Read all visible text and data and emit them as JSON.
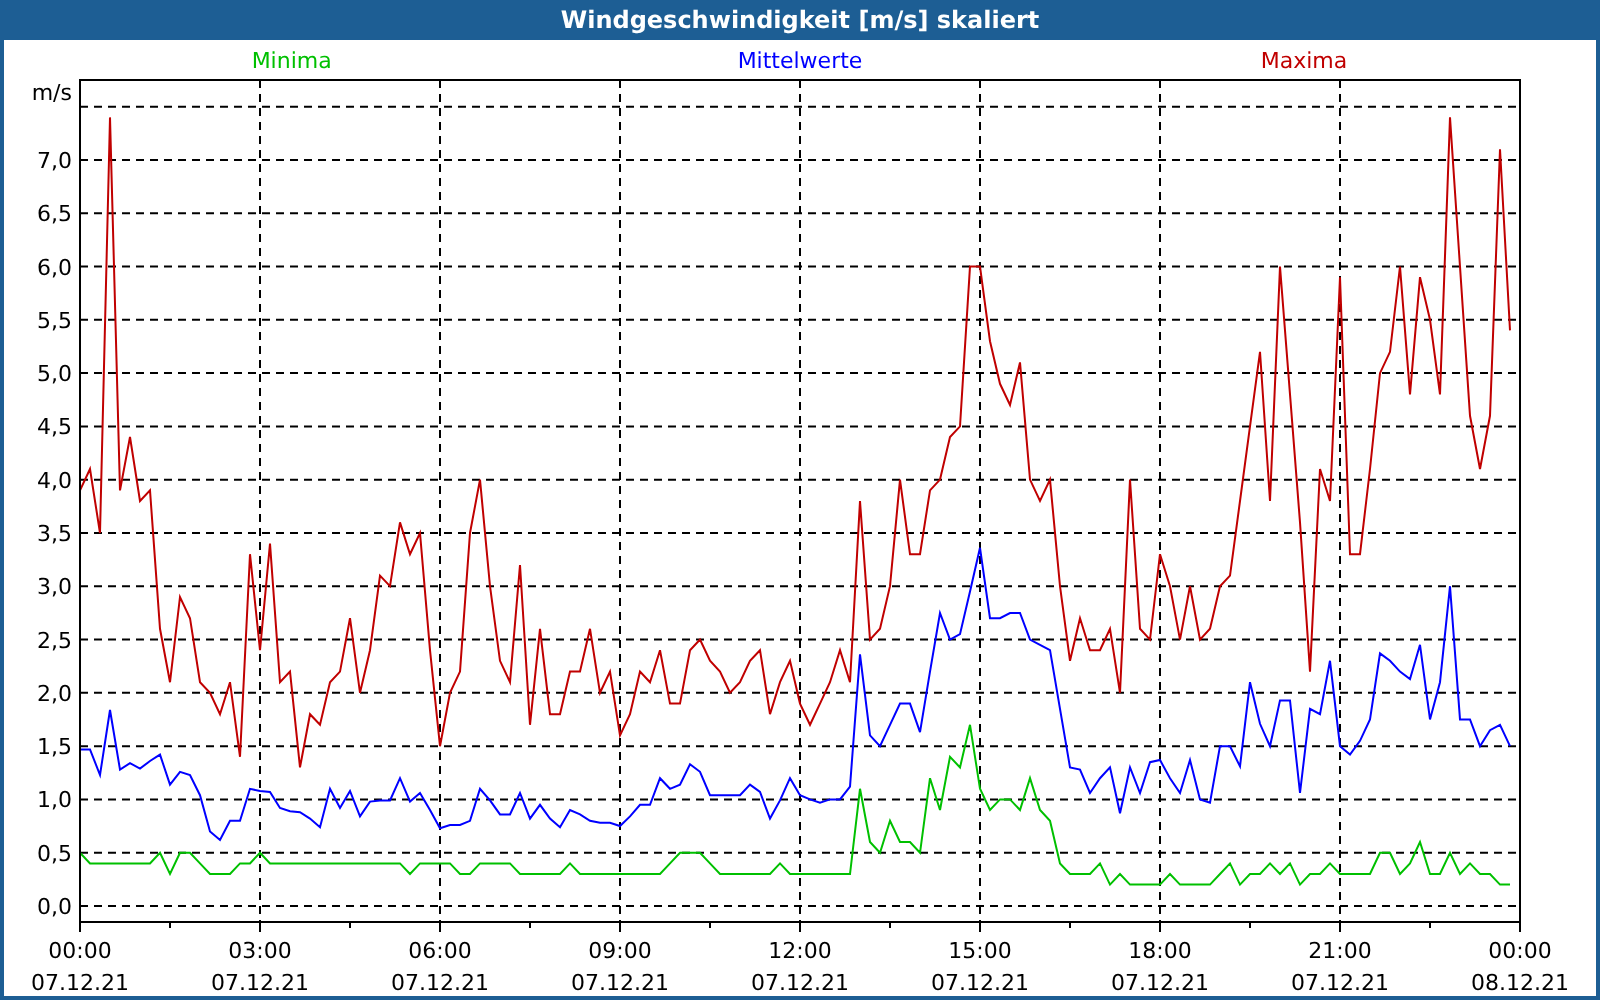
{
  "window": {
    "title": "Windgeschwindigkeit [m/s] skaliert"
  },
  "chart": {
    "chart_data": {
      "type": "line",
      "grid": true,
      "ylabel": "m/s",
      "ylim": [
        -0.15,
        7.75
      ],
      "yticks": [
        {
          "value": 0,
          "label": "0,0"
        },
        {
          "value": 0.5,
          "label": "0,5"
        },
        {
          "value": 1,
          "label": "1,0"
        },
        {
          "value": 1.5,
          "label": "1,5"
        },
        {
          "value": 2,
          "label": "2,0"
        },
        {
          "value": 2.5,
          "label": "2,5"
        },
        {
          "value": 3,
          "label": "3,0"
        },
        {
          "value": 3.5,
          "label": "3,5"
        },
        {
          "value": 4,
          "label": "4,0"
        },
        {
          "value": 4.5,
          "label": "4,5"
        },
        {
          "value": 5,
          "label": "5,0"
        },
        {
          "value": 5.5,
          "label": "5,5"
        },
        {
          "value": 6,
          "label": "6,0"
        },
        {
          "value": 6.5,
          "label": "6,5"
        },
        {
          "value": 7,
          "label": "7,0"
        }
      ],
      "categories": [
        "00:00\n07.12.21",
        null,
        null,
        null,
        null,
        null,
        null,
        null,
        null,
        null,
        null,
        null,
        null,
        null,
        null,
        null,
        null,
        null,
        "03:00\n07.12.21",
        null,
        null,
        null,
        null,
        null,
        null,
        null,
        null,
        null,
        null,
        null,
        null,
        null,
        null,
        null,
        null,
        null,
        "06:00\n07.12.21",
        null,
        null,
        null,
        null,
        null,
        null,
        null,
        null,
        null,
        null,
        null,
        null,
        null,
        null,
        null,
        null,
        null,
        "09:00\n07.12.21",
        null,
        null,
        null,
        null,
        null,
        null,
        null,
        null,
        null,
        null,
        null,
        null,
        null,
        null,
        null,
        null,
        null,
        "12:00\n07.12.21",
        null,
        null,
        null,
        null,
        null,
        null,
        null,
        null,
        null,
        null,
        null,
        null,
        null,
        null,
        null,
        null,
        null,
        "15:00\n07.12.21",
        null,
        null,
        null,
        null,
        null,
        null,
        null,
        null,
        null,
        null,
        null,
        null,
        null,
        null,
        null,
        null,
        null,
        "18:00\n07.12.21",
        null,
        null,
        null,
        null,
        null,
        null,
        null,
        null,
        null,
        null,
        null,
        null,
        null,
        null,
        null,
        null,
        null,
        "21:00\n07.12.21",
        null,
        null,
        null,
        null,
        null,
        null,
        null,
        null,
        null,
        null,
        null,
        null,
        null,
        null,
        null,
        null,
        null,
        "00:00\n08.12.21"
      ],
      "series": [
        {
          "name": "Minima",
          "color": "#00c000",
          "values": [
            0.5,
            0.4,
            0.4,
            0.4,
            0.4,
            0.4,
            0.4,
            0.4,
            0.5,
            0.3,
            0.5,
            0.5,
            0.4,
            0.3,
            0.3,
            0.3,
            0.4,
            0.4,
            0.5,
            0.4,
            0.4,
            0.4,
            0.4,
            0.4,
            0.4,
            0.4,
            0.4,
            0.4,
            0.4,
            0.4,
            0.4,
            0.4,
            0.4,
            0.3,
            0.4,
            0.4,
            0.4,
            0.4,
            0.3,
            0.3,
            0.4,
            0.4,
            0.4,
            0.4,
            0.3,
            0.3,
            0.3,
            0.3,
            0.3,
            0.4,
            0.3,
            0.3,
            0.3,
            0.3,
            0.3,
            0.3,
            0.3,
            0.3,
            0.3,
            0.4,
            0.5,
            0.5,
            0.5,
            0.4,
            0.3,
            0.3,
            0.3,
            0.3,
            0.3,
            0.3,
            0.4,
            0.3,
            0.3,
            0.3,
            0.3,
            0.3,
            0.3,
            0.3,
            1.1,
            0.6,
            0.5,
            0.8,
            0.6,
            0.6,
            0.5,
            1.2,
            0.9,
            1.4,
            1.3,
            1.7,
            1.1,
            0.9,
            1.0,
            1.0,
            0.9,
            1.2,
            0.9,
            0.8,
            0.4,
            0.3,
            0.3,
            0.3,
            0.4,
            0.2,
            0.3,
            0.2,
            0.2,
            0.2,
            0.2,
            0.3,
            0.2,
            0.2,
            0.2,
            0.2,
            0.3,
            0.4,
            0.2,
            0.3,
            0.3,
            0.4,
            0.3,
            0.4,
            0.2,
            0.3,
            0.3,
            0.4,
            0.3,
            0.3,
            0.3,
            0.3,
            0.5,
            0.5,
            0.3,
            0.4,
            0.6,
            0.3,
            0.3,
            0.5,
            0.3,
            0.4,
            0.3,
            0.3,
            0.2,
            0.2,
            null
          ]
        },
        {
          "name": "Mittelwerte",
          "color": "#0000ff",
          "values": [
            1.47,
            1.47,
            1.23,
            1.84,
            1.28,
            1.34,
            1.29,
            1.36,
            1.42,
            1.14,
            1.26,
            1.23,
            1.04,
            0.7,
            0.62,
            0.8,
            0.8,
            1.1,
            1.08,
            1.07,
            0.92,
            0.89,
            0.88,
            0.82,
            0.74,
            1.1,
            0.92,
            1.08,
            0.84,
            0.98,
            0.99,
            0.99,
            1.2,
            0.98,
            1.06,
            0.9,
            0.73,
            0.76,
            0.76,
            0.8,
            1.1,
            0.99,
            0.86,
            0.86,
            1.06,
            0.82,
            0.95,
            0.82,
            0.74,
            0.9,
            0.86,
            0.8,
            0.78,
            0.78,
            0.75,
            0.84,
            0.95,
            0.95,
            1.2,
            1.1,
            1.14,
            1.33,
            1.26,
            1.04,
            1.04,
            1.04,
            1.04,
            1.14,
            1.07,
            0.82,
            0.99,
            1.2,
            1.04,
            1.0,
            0.97,
            1.0,
            1.0,
            1.12,
            2.36,
            1.6,
            1.5,
            1.7,
            1.9,
            1.9,
            1.63,
            2.2,
            2.75,
            2.5,
            2.55,
            2.95,
            3.36,
            2.7,
            2.7,
            2.75,
            2.75,
            2.5,
            2.45,
            2.4,
            1.85,
            1.3,
            1.28,
            1.06,
            1.2,
            1.3,
            0.87,
            1.3,
            1.06,
            1.35,
            1.37,
            1.2,
            1.06,
            1.37,
            1.0,
            0.97,
            1.5,
            1.5,
            1.31,
            2.1,
            1.71,
            1.5,
            1.93,
            1.93,
            1.06,
            1.85,
            1.8,
            2.3,
            1.5,
            1.42,
            1.55,
            1.75,
            2.37,
            2.3,
            2.2,
            2.13,
            2.45,
            1.75,
            2.1,
            3.0,
            1.75,
            1.75,
            1.5,
            1.65,
            1.7,
            1.5,
            null
          ]
        },
        {
          "name": "Maxima",
          "color": "#c00000",
          "values": [
            3.9,
            4.1,
            3.5,
            7.4,
            3.9,
            4.4,
            3.8,
            3.9,
            2.6,
            2.1,
            2.9,
            2.7,
            2.1,
            2.0,
            1.8,
            2.1,
            1.4,
            3.3,
            2.4,
            3.4,
            2.1,
            2.2,
            1.3,
            1.8,
            1.7,
            2.1,
            2.2,
            2.7,
            2.0,
            2.4,
            3.1,
            3.0,
            3.6,
            3.3,
            3.5,
            2.4,
            1.5,
            2.0,
            2.2,
            3.5,
            4.0,
            3.0,
            2.3,
            2.1,
            3.2,
            1.7,
            2.6,
            1.8,
            1.8,
            2.2,
            2.2,
            2.6,
            2.0,
            2.2,
            1.6,
            1.8,
            2.2,
            2.1,
            2.4,
            1.9,
            1.9,
            2.4,
            2.5,
            2.3,
            2.2,
            2.0,
            2.1,
            2.3,
            2.4,
            1.8,
            2.1,
            2.3,
            1.9,
            1.7,
            1.9,
            2.1,
            2.4,
            2.1,
            3.8,
            2.5,
            2.6,
            3.0,
            4.0,
            3.3,
            3.3,
            3.9,
            4.0,
            4.4,
            4.5,
            6.0,
            6.0,
            5.3,
            4.9,
            4.7,
            5.1,
            4.0,
            3.8,
            4.0,
            3.0,
            2.3,
            2.7,
            2.4,
            2.4,
            2.6,
            2.0,
            4.0,
            2.6,
            2.5,
            3.3,
            3.0,
            2.5,
            3.0,
            2.5,
            2.6,
            3.0,
            3.1,
            3.8,
            4.5,
            5.2,
            3.8,
            6.0,
            4.8,
            3.6,
            2.2,
            4.1,
            3.8,
            5.9,
            3.3,
            3.3,
            4.1,
            5.0,
            5.2,
            6.0,
            4.8,
            5.9,
            5.5,
            4.8,
            7.4,
            6.0,
            4.6,
            4.1,
            4.6,
            7.1,
            5.4,
            null
          ]
        }
      ]
    }
  }
}
